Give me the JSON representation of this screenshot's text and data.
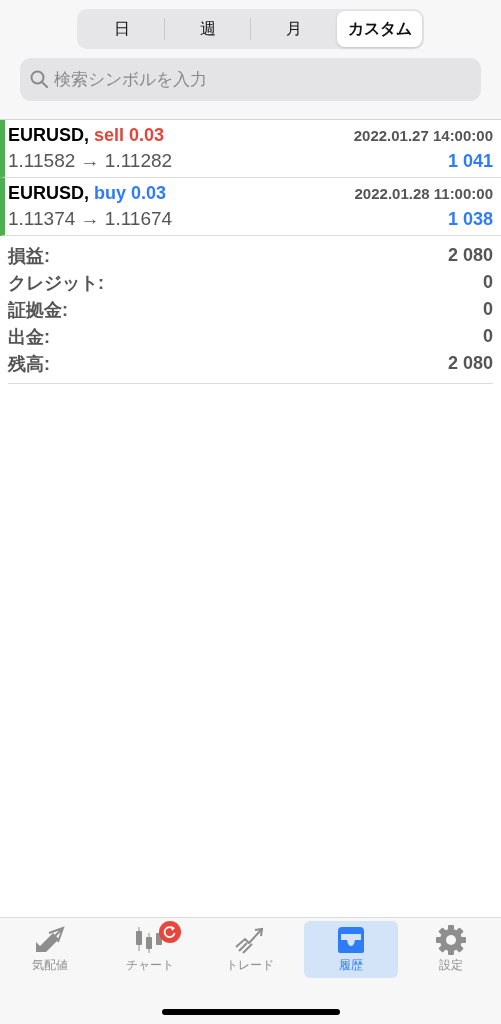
{
  "periods": [
    {
      "label": "日",
      "selected": false
    },
    {
      "label": "週",
      "selected": false
    },
    {
      "label": "月",
      "selected": false
    },
    {
      "label": "カスタム",
      "selected": true
    }
  ],
  "search": {
    "placeholder": "検索シンボルを入力"
  },
  "trades": [
    {
      "symbol": "EURUSD,",
      "kind": "sell",
      "side": "sell 0.03",
      "time": "2022.01.27 14:00:00",
      "prices": "1.11582 → 1.11282",
      "profit": "1 041"
    },
    {
      "symbol": "EURUSD,",
      "kind": "buy",
      "side": "buy 0.03",
      "time": "2022.01.28 11:00:00",
      "prices": "1.11374 → 1.11674",
      "profit": "1 038"
    }
  ],
  "summary": [
    {
      "label": "損益:",
      "value": "2 080"
    },
    {
      "label": "クレジット:",
      "value": "0"
    },
    {
      "label": "証拠金:",
      "value": "0"
    },
    {
      "label": "出金:",
      "value": "0"
    },
    {
      "label": "残高:",
      "value": "2 080"
    }
  ],
  "tab_bar": [
    {
      "kind": "quotes",
      "label": "気配値",
      "selected": false
    },
    {
      "kind": "chart",
      "label": "チャート",
      "selected": false,
      "badge": true
    },
    {
      "kind": "trade",
      "label": "トレード",
      "selected": false
    },
    {
      "kind": "history",
      "label": "履歴",
      "selected": true
    },
    {
      "kind": "settings",
      "label": "設定",
      "selected": false
    }
  ]
}
